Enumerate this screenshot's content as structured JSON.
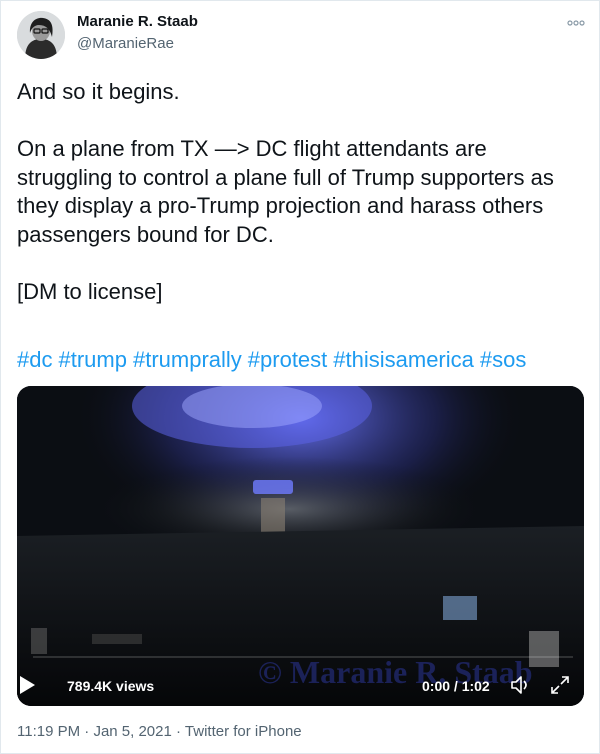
{
  "tweet": {
    "author_name": "Maranie R. Staab",
    "author_handle": "@MaranieRae",
    "line1": "And so it begins.",
    "paragraph": [
      "On a plane from TX —> DC flight attendants are",
      "struggling to control a plane full of Trump supporters as",
      "they display a pro-Trump projection and harass others",
      "passengers bound for DC."
    ],
    "license": "[DM to license]",
    "hashtags": [
      "#dc",
      "#trump",
      "#trumprally",
      "#protest",
      "#thisisamerica",
      "#sos"
    ]
  },
  "video": {
    "views": "789.4K views",
    "time": "0:00 / 1:02",
    "watermark": "© Maranie R. Staab",
    "progress": 0
  },
  "footer": {
    "time": "11:19 PM",
    "sep1": " · ",
    "date": "Jan 5, 2021",
    "sep2": " · ",
    "source": "Twitter for iPhone"
  },
  "icons": {
    "more": "more-icon",
    "play": "play-icon",
    "volume": "volume-muted-icon",
    "fullscreen": "fullscreen-icon"
  },
  "colors": {
    "link": "#1d9bf0",
    "secondary_text": "#536471",
    "primary_text": "#0f1419"
  }
}
